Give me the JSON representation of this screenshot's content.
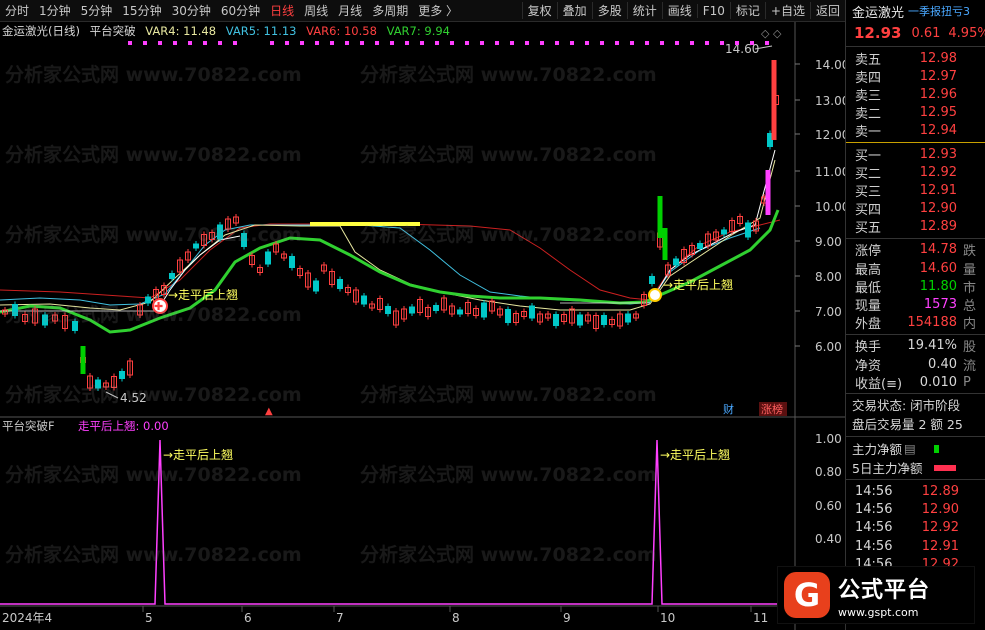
{
  "toolbar": {
    "timeframes": [
      "分时",
      "1分钟",
      "5分钟",
      "15分钟",
      "30分钟",
      "60分钟",
      "日线",
      "周线",
      "月线",
      "多周期",
      "更多 〉"
    ],
    "active_timeframe": "日线",
    "tools": [
      "复权",
      "叠加",
      "多股",
      "统计",
      "画线",
      "F10",
      "标记",
      "+自选",
      "返回"
    ]
  },
  "legend": {
    "title": "金运激光(日线)",
    "indicator": "平台突破",
    "var4": "VAR4: 11.48",
    "var5": "VAR5: 11.13",
    "var6": "VAR6: 10.58",
    "var7": "VAR7: 9.94"
  },
  "colors": {
    "up": "#ff4040",
    "down": "#00c8c8",
    "green": "#00d000",
    "magenta": "#ff40ff",
    "yellow": "#ffff40"
  },
  "main_chart": {
    "y_ticks": [
      "14.00",
      "13.00",
      "12.00",
      "11.00",
      "10.00",
      "9.00",
      "8.00",
      "7.00",
      "6.00"
    ],
    "high_label": "14.60",
    "low_label": "4.52",
    "signal_label_1": "→走平后上翘",
    "signal_label_2": "→走平后上翘",
    "bottom_tags": [
      "财",
      "涨榜"
    ]
  },
  "sub_chart": {
    "title": "平台突破F",
    "value": "走平后上翘: 0.00",
    "y_ticks": [
      "1.00",
      "0.80",
      "0.60",
      "0.40"
    ],
    "label_1": "→走平后上翘",
    "label_2": "→走平后上翘"
  },
  "x_axis": [
    "2024年4",
    "5",
    "6",
    "7",
    "8",
    "9",
    "10",
    "11"
  ],
  "quote": {
    "name": "金运激光",
    "tag": "一季报扭亏",
    "tag_suffix": "3",
    "price": "12.93",
    "change": "0.61",
    "change_pct": "4.95%",
    "asks": [
      {
        "label": "卖五",
        "price": "12.98"
      },
      {
        "label": "卖四",
        "price": "12.97"
      },
      {
        "label": "卖三",
        "price": "12.96"
      },
      {
        "label": "卖二",
        "price": "12.95"
      },
      {
        "label": "卖一",
        "price": "12.94"
      }
    ],
    "bids": [
      {
        "label": "买一",
        "price": "12.93"
      },
      {
        "label": "买二",
        "price": "12.92"
      },
      {
        "label": "买三",
        "price": "12.91"
      },
      {
        "label": "买四",
        "price": "12.90"
      },
      {
        "label": "买五",
        "price": "12.89"
      }
    ],
    "stats": [
      {
        "label": "涨停",
        "value": "14.78",
        "tail": "跌"
      },
      {
        "label": "最高",
        "value": "14.60",
        "tail": "量"
      },
      {
        "label": "最低",
        "value": "11.80",
        "tail": "市"
      },
      {
        "label": "现量",
        "value": "1573",
        "tail": "总"
      },
      {
        "label": "外盘",
        "value": "154188",
        "tail": "内"
      },
      {
        "label": "换手",
        "value": "19.41%",
        "tail": "股"
      },
      {
        "label": "净资",
        "value": "0.40",
        "tail": "流"
      },
      {
        "label": "收益(≡)",
        "value": "0.010",
        "tail": "P"
      }
    ],
    "trade_status": "交易状态: 闭市阶段",
    "after_hours": "盘后交易量 2 额 25",
    "main_flow": "主力净额",
    "main_flow_5d": "5日主力净额",
    "ticks": [
      {
        "time": "14:56",
        "price": "12.89"
      },
      {
        "time": "14:56",
        "price": "12.90"
      },
      {
        "time": "14:56",
        "price": "12.92"
      },
      {
        "time": "14:56",
        "price": "12.91"
      },
      {
        "time": "14:56",
        "price": "12.92"
      }
    ]
  },
  "logo": {
    "title": "公式平台",
    "url": "www.gspt.com"
  },
  "watermark": "分析家公式网 www.70822.com"
}
